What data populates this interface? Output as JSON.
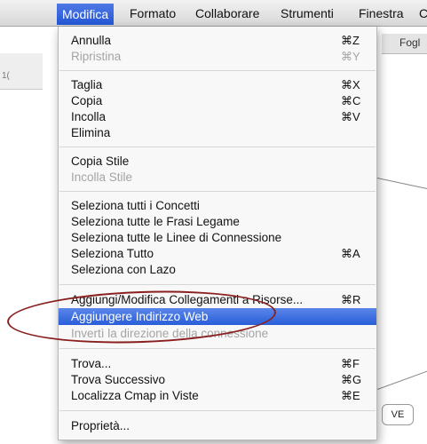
{
  "menubar": {
    "items": [
      "Modifica",
      "Formato",
      "Collaborare",
      "Strumenti",
      "Finestra",
      "C"
    ]
  },
  "background": {
    "tab_label": "Fogl",
    "ruler_label": "1(",
    "box_label": "VE"
  },
  "menu": {
    "items": [
      {
        "label": "Annulla",
        "shortcut": "⌘Z",
        "state": "enabled"
      },
      {
        "label": "Ripristina",
        "shortcut": "⌘Y",
        "state": "disabled"
      },
      {
        "label": "Taglia",
        "shortcut": "⌘X",
        "state": "enabled"
      },
      {
        "label": "Copia",
        "shortcut": "⌘C",
        "state": "enabled"
      },
      {
        "label": "Incolla",
        "shortcut": "⌘V",
        "state": "enabled"
      },
      {
        "label": "Elimina",
        "shortcut": "",
        "state": "enabled"
      },
      {
        "label": "Copia Stile",
        "shortcut": "",
        "state": "enabled"
      },
      {
        "label": "Incolla Stile",
        "shortcut": "",
        "state": "disabled"
      },
      {
        "label": "Seleziona tutti i Concetti",
        "shortcut": "",
        "state": "enabled"
      },
      {
        "label": "Seleziona tutte le Frasi Legame",
        "shortcut": "",
        "state": "enabled"
      },
      {
        "label": "Seleziona tutte le Linee di Connessione",
        "shortcut": "",
        "state": "enabled"
      },
      {
        "label": "Seleziona Tutto",
        "shortcut": "⌘A",
        "state": "enabled"
      },
      {
        "label": "Seleziona con Lazo",
        "shortcut": "",
        "state": "enabled"
      },
      {
        "label": "Aggiungi/Modifica Collegamenti a Risorse...",
        "shortcut": "⌘R",
        "state": "enabled"
      },
      {
        "label": "Aggiungere Indirizzo Web",
        "shortcut": "",
        "state": "highlighted"
      },
      {
        "label": "Invertì la direzione della connessione",
        "shortcut": "",
        "state": "disabled"
      },
      {
        "label": "Trova...",
        "shortcut": "⌘F",
        "state": "enabled"
      },
      {
        "label": "Trova Successivo",
        "shortcut": "⌘G",
        "state": "enabled"
      },
      {
        "label": "Localizza Cmap in Viste",
        "shortcut": "⌘E",
        "state": "enabled"
      },
      {
        "label": "Proprietà...",
        "shortcut": "",
        "state": "enabled"
      }
    ]
  },
  "colors": {
    "highlight": "#2a5fd9",
    "annotation": "#8a1f1f"
  }
}
